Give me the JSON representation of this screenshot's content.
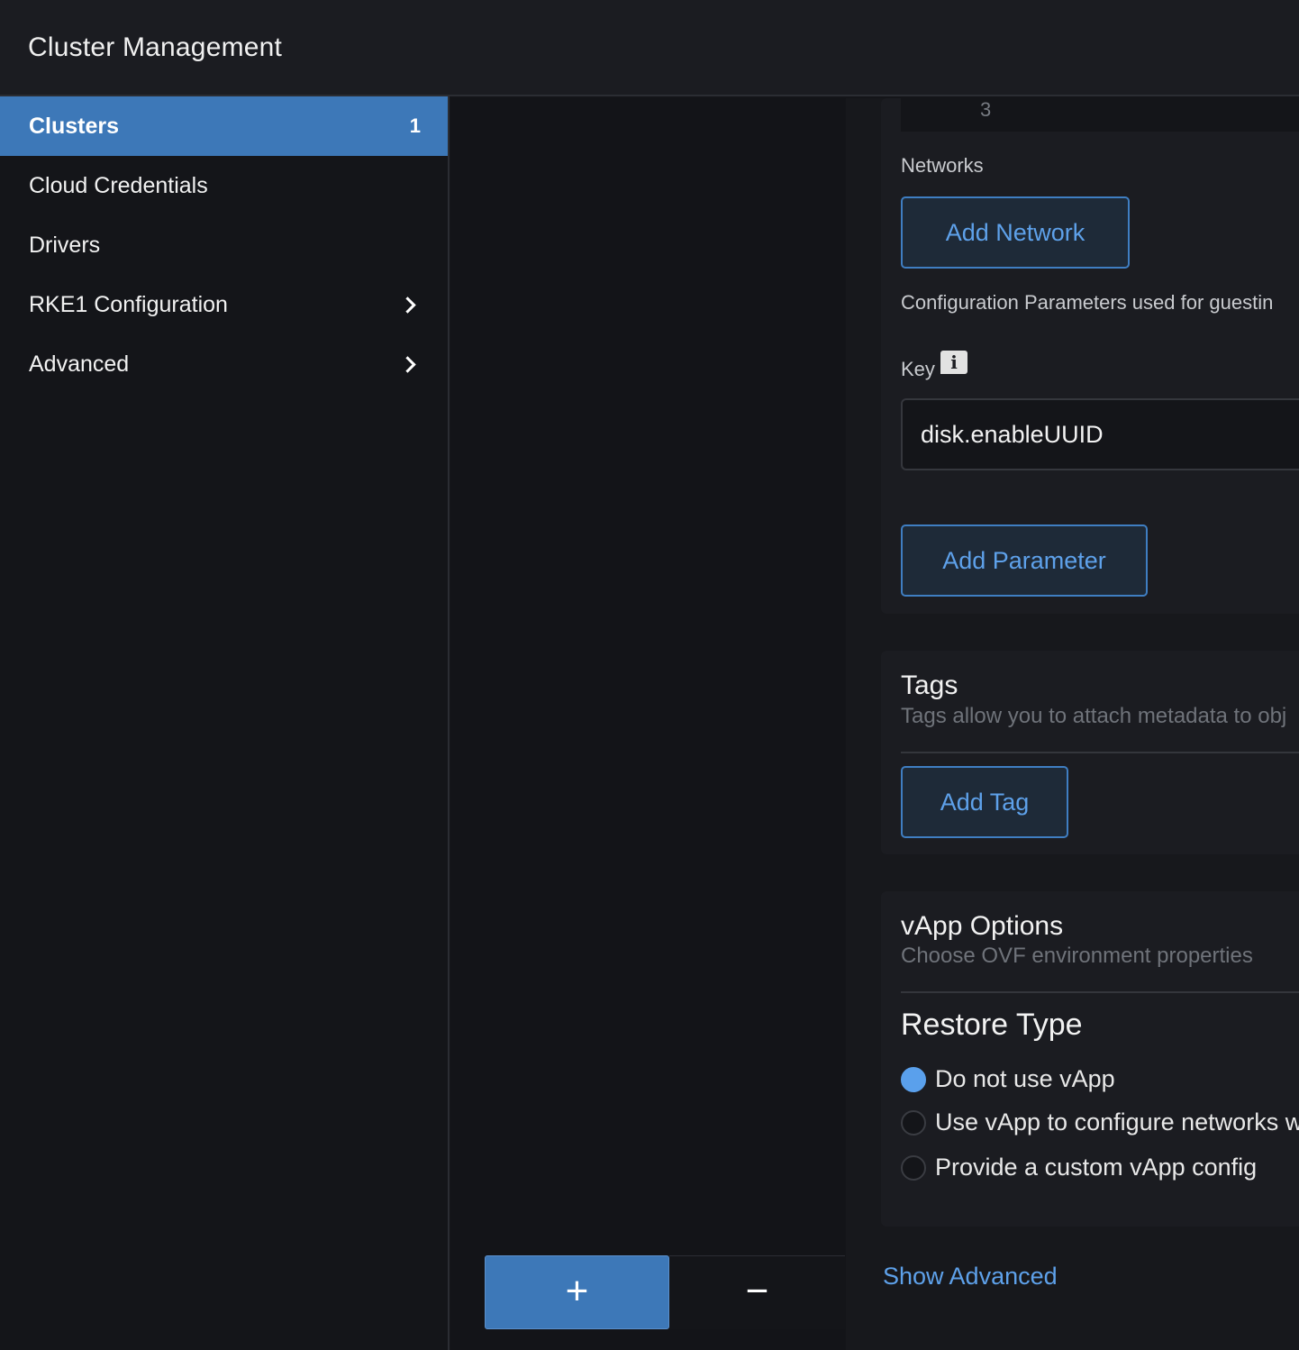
{
  "header": {
    "title": "Cluster Management"
  },
  "sidebar": {
    "items": [
      {
        "label": "Clusters",
        "count": "1",
        "active": true
      },
      {
        "label": "Cloud Credentials"
      },
      {
        "label": "Drivers"
      },
      {
        "label": "RKE1 Configuration",
        "expandable": true
      },
      {
        "label": "Advanced",
        "expandable": true
      }
    ]
  },
  "form": {
    "number_value": "3",
    "networks_label": "Networks",
    "add_network_label": "Add Network",
    "config_params_label": "Configuration Parameters used for guestin",
    "key_label": "Key",
    "info_icon": "i",
    "key_value": "disk.enableUUID",
    "add_parameter_label": "Add Parameter"
  },
  "tags": {
    "title": "Tags",
    "subtitle": "Tags allow you to attach metadata to obj",
    "add_tag_label": "Add Tag"
  },
  "vapp": {
    "title": "vApp Options",
    "subtitle": "Choose OVF environment properties",
    "restore_type_title": "Restore Type",
    "options": [
      {
        "label": "Do not use vApp",
        "checked": true
      },
      {
        "label": "Use vApp to configure networks w"
      },
      {
        "label": "Provide a custom vApp config"
      }
    ]
  },
  "stepper": {
    "plus": "+",
    "minus": "−"
  },
  "show_advanced_label": "Show Advanced",
  "colors": {
    "accent": "#3d78b8",
    "link": "#5ea1ea",
    "background": "#141519"
  }
}
